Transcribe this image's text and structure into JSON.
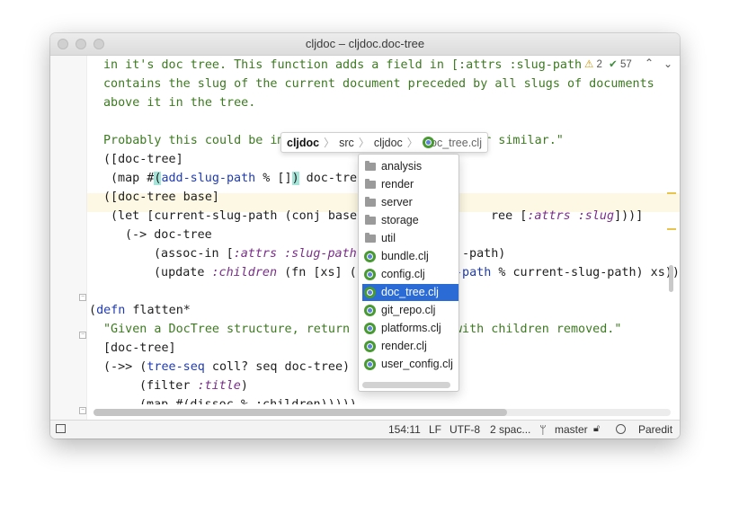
{
  "window": {
    "title": "cljdoc – cljdoc.doc-tree"
  },
  "inspections": {
    "warnings": "2",
    "ok": "57",
    "warn_icon": "warning-triangle-icon",
    "ok_icon": "double-check-icon"
  },
  "code": {
    "l1": "in it's doc tree. This function adds a field in [:attrs :slug-path",
    "l2": "contains the slug of the current document preceded by all slugs of documents",
    "l3": "above it in the tree.",
    "l5a": "Probably this could be im",
    "l5b": "s or similar.\"",
    "l6": "([doc-tree]",
    "l7a": "(map #",
    "l7b": "(",
    "l7c": "add-slug-path",
    "l7d": " % []",
    "l7e": ")",
    "l7f": " doc-tre",
    "l8": "([doc-tree base]",
    "l9a": "(let [current-slug-path (conj base",
    "l9b": "ree [",
    "l9c": ":attrs :slug",
    "l9d": "]))]",
    "l10": "(-> doc-tree",
    "l11a": "(assoc-in [",
    "l11b": ":attrs :slug-path",
    "l11c": "-path)",
    "l12a": "(update ",
    "l12b": ":children",
    "l12c": " (fn [xs] (",
    "l12d": "-path",
    "l12e": " % current-slug-path) xs)",
    "l12f": ")",
    "l14a": "(",
    "l14b": "defn",
    "l14c": " flatten*",
    "l15a": "\"Given a DocTree structure, return ",
    "l15b": "with children removed.\"",
    "l16": "[doc-tree]",
    "l17a": "(->> (",
    "l17b": "tree-seq",
    "l17c": " coll? seq doc-tree)",
    "l18a": "(filter ",
    "l18b": ":title",
    "l18c": ")",
    "l19": "(map #(dissoc % :children)))))"
  },
  "breadcrumb": [
    "cljdoc",
    "src",
    "cljdoc",
    "doc_tree.clj"
  ],
  "popup": {
    "items": [
      {
        "label": "analysis",
        "kind": "folder"
      },
      {
        "label": "render",
        "kind": "folder"
      },
      {
        "label": "server",
        "kind": "folder"
      },
      {
        "label": "storage",
        "kind": "folder"
      },
      {
        "label": "util",
        "kind": "folder"
      },
      {
        "label": "bundle.clj",
        "kind": "clj"
      },
      {
        "label": "config.clj",
        "kind": "clj"
      },
      {
        "label": "doc_tree.clj",
        "kind": "clj",
        "selected": true
      },
      {
        "label": "git_repo.clj",
        "kind": "clj"
      },
      {
        "label": "platforms.clj",
        "kind": "clj"
      },
      {
        "label": "render.clj",
        "kind": "clj"
      },
      {
        "label": "user_config.clj",
        "kind": "clj"
      }
    ]
  },
  "status": {
    "position": "154:11",
    "line_sep": "LF",
    "encoding": "UTF-8",
    "indent": "2 spac...",
    "branch": "master",
    "mode": "Paredit"
  },
  "colors": {
    "string": "#3d7a21",
    "keyword": "#7a2d89",
    "selection": "#2a6bd6",
    "current_line": "#fcf8e3"
  }
}
